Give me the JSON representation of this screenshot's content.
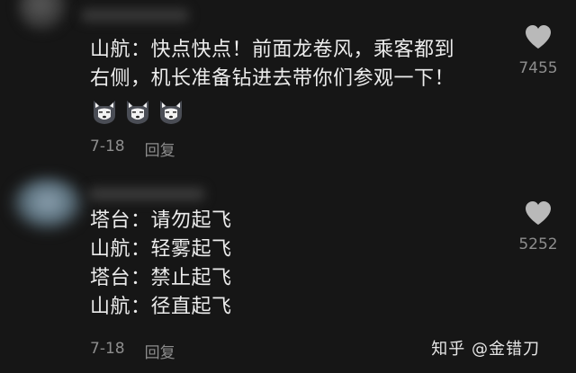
{
  "comments": [
    {
      "lines": [
        "山航：快点快点！前面龙卷风，乘客都到",
        "右侧，机长准备钻进去带你们参观一下！"
      ],
      "emojis": [
        "husky-emoji",
        "husky-emoji",
        "husky-emoji"
      ],
      "date": "7-18",
      "reply_label": "回复",
      "likes": "7455"
    },
    {
      "lines": [
        "塔台：请勿起飞",
        "山航：轻雾起飞",
        "塔台：禁止起飞",
        "山航：径直起飞"
      ],
      "date": "7-18",
      "reply_label": "回复",
      "likes": "5252"
    }
  ],
  "watermark": "知乎 @金错刀",
  "icons": {
    "like": "heart-icon"
  },
  "colors": {
    "background": "#161616",
    "text": "#ececec",
    "muted": "#8d8d8d"
  }
}
